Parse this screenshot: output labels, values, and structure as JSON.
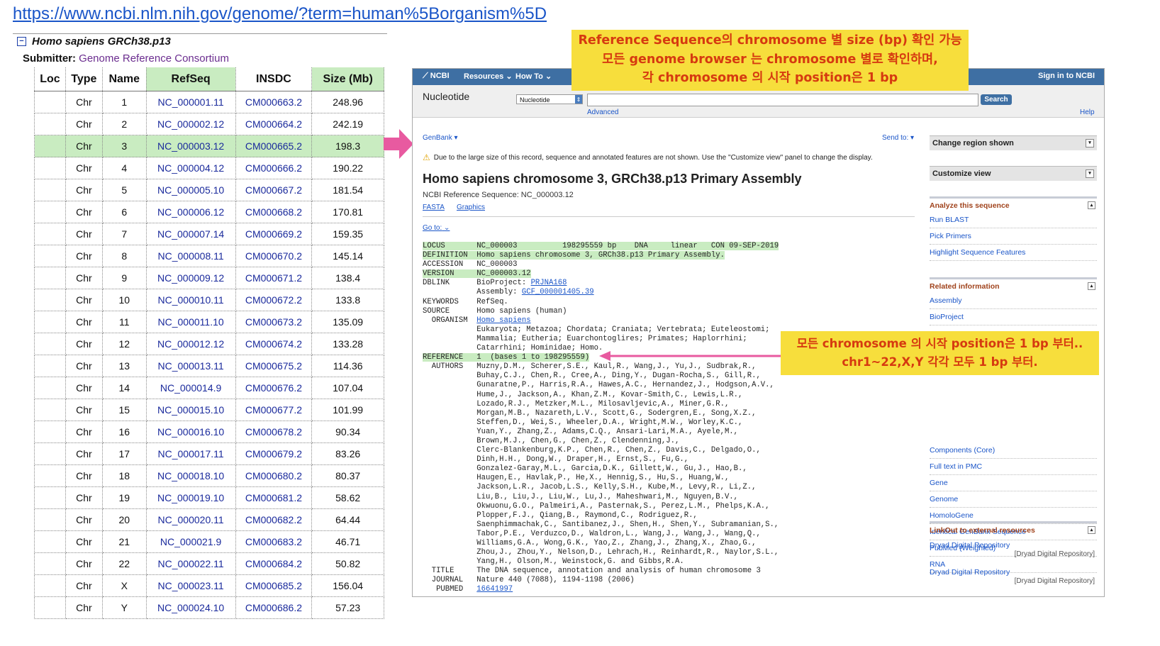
{
  "url": "https://www.ncbi.nlm.nih.gov/genome/?term=human%5Borganism%5D",
  "genome_table": {
    "title": "Homo sapiens GRCh38.p13",
    "submitter_label": "Submitter:",
    "submitter_value": "Genome Reference Consortium",
    "headers": [
      "Loc",
      "Type",
      "Name",
      "RefSeq",
      "INSDC",
      "Size (Mb)"
    ],
    "rows": [
      {
        "type": "Chr",
        "name": "1",
        "refseq": "NC_000001.11",
        "insdc": "CM000663.2",
        "size": "248.96"
      },
      {
        "type": "Chr",
        "name": "2",
        "refseq": "NC_000002.12",
        "insdc": "CM000664.2",
        "size": "242.19"
      },
      {
        "type": "Chr",
        "name": "3",
        "refseq": "NC_000003.12",
        "insdc": "CM000665.2",
        "size": "198.3"
      },
      {
        "type": "Chr",
        "name": "4",
        "refseq": "NC_000004.12",
        "insdc": "CM000666.2",
        "size": "190.22"
      },
      {
        "type": "Chr",
        "name": "5",
        "refseq": "NC_000005.10",
        "insdc": "CM000667.2",
        "size": "181.54"
      },
      {
        "type": "Chr",
        "name": "6",
        "refseq": "NC_000006.12",
        "insdc": "CM000668.2",
        "size": "170.81"
      },
      {
        "type": "Chr",
        "name": "7",
        "refseq": "NC_000007.14",
        "insdc": "CM000669.2",
        "size": "159.35"
      },
      {
        "type": "Chr",
        "name": "8",
        "refseq": "NC_000008.11",
        "insdc": "CM000670.2",
        "size": "145.14"
      },
      {
        "type": "Chr",
        "name": "9",
        "refseq": "NC_000009.12",
        "insdc": "CM000671.2",
        "size": "138.4"
      },
      {
        "type": "Chr",
        "name": "10",
        "refseq": "NC_000010.11",
        "insdc": "CM000672.2",
        "size": "133.8"
      },
      {
        "type": "Chr",
        "name": "11",
        "refseq": "NC_000011.10",
        "insdc": "CM000673.2",
        "size": "135.09"
      },
      {
        "type": "Chr",
        "name": "12",
        "refseq": "NC_000012.12",
        "insdc": "CM000674.2",
        "size": "133.28"
      },
      {
        "type": "Chr",
        "name": "13",
        "refseq": "NC_000013.11",
        "insdc": "CM000675.2",
        "size": "114.36"
      },
      {
        "type": "Chr",
        "name": "14",
        "refseq": "NC_000014.9",
        "insdc": "CM000676.2",
        "size": "107.04"
      },
      {
        "type": "Chr",
        "name": "15",
        "refseq": "NC_000015.10",
        "insdc": "CM000677.2",
        "size": "101.99"
      },
      {
        "type": "Chr",
        "name": "16",
        "refseq": "NC_000016.10",
        "insdc": "CM000678.2",
        "size": "90.34"
      },
      {
        "type": "Chr",
        "name": "17",
        "refseq": "NC_000017.11",
        "insdc": "CM000679.2",
        "size": "83.26"
      },
      {
        "type": "Chr",
        "name": "18",
        "refseq": "NC_000018.10",
        "insdc": "CM000680.2",
        "size": "80.37"
      },
      {
        "type": "Chr",
        "name": "19",
        "refseq": "NC_000019.10",
        "insdc": "CM000681.2",
        "size": "58.62"
      },
      {
        "type": "Chr",
        "name": "20",
        "refseq": "NC_000020.11",
        "insdc": "CM000682.2",
        "size": "64.44"
      },
      {
        "type": "Chr",
        "name": "21",
        "refseq": "NC_000021.9",
        "insdc": "CM000683.2",
        "size": "46.71"
      },
      {
        "type": "Chr",
        "name": "22",
        "refseq": "NC_000022.11",
        "insdc": "CM000684.2",
        "size": "50.82"
      },
      {
        "type": "Chr",
        "name": "X",
        "refseq": "NC_000023.11",
        "insdc": "CM000685.2",
        "size": "156.04"
      },
      {
        "type": "Chr",
        "name": "Y",
        "refseq": "NC_000024.10",
        "insdc": "CM000686.2",
        "size": "57.23"
      }
    ],
    "highlighted_row": "3"
  },
  "ncbi": {
    "bar": {
      "logo": "NCBI",
      "resources": "Resources",
      "howto": "How To",
      "signin": "Sign in to NCBI"
    },
    "db_title": "Nucleotide",
    "db_select": "Nucleotide",
    "search_value": "",
    "search_button": "Search",
    "advanced": "Advanced",
    "help": "Help",
    "format_dropdown": "GenBank",
    "send_to": "Send to:",
    "warning": "Due to the large size of this record, sequence and annotated features are not shown. Use the \"Customize view\" panel to change the display.",
    "record_title": "Homo sapiens chromosome 3, GRCh38.p13 Primary Assembly",
    "refseq_line": "NCBI Reference Sequence: NC_000003.12",
    "fasta": "FASTA",
    "graphics": "Graphics",
    "goto": "Go to:",
    "genbank_lines": [
      "LOCUS       NC_000003          198295559 bp    DNA     linear   CON 09-SEP-2019",
      "DEFINITION  Homo sapiens chromosome 3, GRCh38.p13 Primary Assembly.",
      "ACCESSION   NC_000003",
      "VERSION     NC_000003.12",
      "DBLINK      BioProject: PRJNA168",
      "            Assembly: GCF_000001405.39",
      "KEYWORDS    RefSeq.",
      "SOURCE      Homo sapiens (human)",
      "  ORGANISM  Homo sapiens",
      "            Eukaryota; Metazoa; Chordata; Craniata; Vertebrata; Euteleostomi;",
      "            Mammalia; Eutheria; Euarchontoglires; Primates; Haplorrhini;",
      "            Catarrhini; Hominidae; Homo.",
      "REFERENCE   1  (bases 1 to 198295559)",
      "  AUTHORS   Muzny,D.M., Scherer,S.E., Kaul,R., Wang,J., Yu,J., Sudbrak,R.,",
      "            Buhay,C.J., Chen,R., Cree,A., Ding,Y., Dugan-Rocha,S., Gill,R.,",
      "            Gunaratne,P., Harris,R.A., Hawes,A.C., Hernandez,J., Hodgson,A.V.,",
      "            Hume,J., Jackson,A., Khan,Z.M., Kovar-Smith,C., Lewis,L.R.,",
      "            Lozado,R.J., Metzker,M.L., Milosavljevic,A., Miner,G.R.,",
      "            Morgan,M.B., Nazareth,L.V., Scott,G., Sodergren,E., Song,X.Z.,",
      "            Steffen,D., Wei,S., Wheeler,D.A., Wright,M.W., Worley,K.C.,",
      "            Yuan,Y., Zhang,Z., Adams,C.Q., Ansari-Lari,M.A., Ayele,M.,",
      "            Brown,M.J., Chen,G., Chen,Z., Clendenning,J.,",
      "            Clerc-Blankenburg,K.P., Chen,R., Chen,Z., Davis,C., Delgado,O.,",
      "            Dinh,H.H., Dong,W., Draper,H., Ernst,S., Fu,G.,",
      "            Gonzalez-Garay,M.L., Garcia,D.K., Gillett,W., Gu,J., Hao,B.,",
      "            Haugen,E., Havlak,P., He,X., Hennig,S., Hu,S., Huang,W.,",
      "            Jackson,L.R., Jacob,L.S., Kelly,S.H., Kube,M., Levy,R., Li,Z.,",
      "            Liu,B., Liu,J., Liu,W., Lu,J., Maheshwari,M., Nguyen,B.V.,",
      "            Okwuonu,G.O., Palmeiri,A., Pasternak,S., Perez,L.M., Phelps,K.A.,",
      "            Plopper,F.J., Qiang,B., Raymond,C., Rodriguez,R.,",
      "            Saenphimmachak,C., Santibanez,J., Shen,H., Shen,Y., Subramanian,S.,",
      "            Tabor,P.E., Verduzco,D., Waldron,L., Wang,J., Wang,J., Wang,Q.,",
      "            Williams,G.A., Wong,G.K., Yao,Z., Zhang,J., Zhang,X., Zhao,G.,",
      "            Zhou,J., Zhou,Y., Nelson,D., Lehrach,H., Reinhardt,R., Naylor,S.L.,",
      "            Yang,H., Olson,M., Weinstock,G. and Gibbs,R.A.",
      "  TITLE     The DNA sequence, annotation and analysis of human chromosome 3",
      "  JOURNAL   Nature 440 (7088), 1194-1198 (2006)",
      "   PUBMED   16641997"
    ],
    "sidebar": {
      "change_region": "Change region shown",
      "customize_view": "Customize view",
      "analyze_title": "Analyze this sequence",
      "analyze_links": [
        "Run BLAST",
        "Pick Primers",
        "Highlight Sequence Features"
      ],
      "related_title": "Related information",
      "related_links": [
        "Assembly",
        "BioProject",
        "Components (Core)",
        "Full text in PMC",
        "Gene",
        "Genome",
        "HomoloGene",
        "Identical GenBank Sequence",
        "PubMed (Weighted)",
        "RNA"
      ],
      "linkout_title": "LinkOut to external resources",
      "linkout_links": [
        {
          "label": "Dryad Digital Repository",
          "source": "[Dryad Digital Repository]"
        },
        {
          "label": "Dryad Digital Repository",
          "source": "[Dryad Digital Repository]"
        }
      ]
    }
  },
  "annotations": {
    "callout1_lines": [
      "Reference Sequence의 chromosome 별 size (bp) 확인 가능",
      "모든 genome browser 는 chromosome 별로 확인하며,",
      "각 chromosome 의 시작 position은 1 bp"
    ],
    "callout2_lines": [
      "모든 chromosome 의 시작 position은 1 bp 부터..",
      "chr1~22,X,Y 각각 모두 1 bp 부터."
    ],
    "highlight_color": "#c9ecc1",
    "callout_color": "#f7de3c",
    "arrow_color": "#e85aa0"
  }
}
